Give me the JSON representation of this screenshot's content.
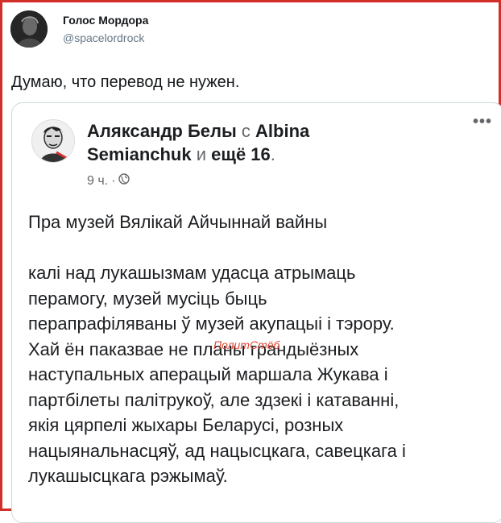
{
  "tweet": {
    "author_name": "Голос Мордора",
    "author_handle": "@spacelordrock",
    "text": "Думаю, что перевод не нужен."
  },
  "embedded_post": {
    "author": "Аляксандр Белы",
    "with_word": "с",
    "tagged_line1": "Albina",
    "tagged_line2": "Semianchuk",
    "and_word": "и",
    "others": "ещё 16",
    "period": ".",
    "time": "9 ч.",
    "separator": "·",
    "privacy_icon": "globe-icon",
    "more_icon": "more-dots-icon",
    "title": "Пра музей Вялікай Айчыннай вайны",
    "body_lines": [
      "калі над лукашызмам удасца атрымаць",
      "перамогу, музей мусіць быць",
      "перапрафіляваны ў музей акупацыі і тэрору.",
      "Хай ён паказвае не планы грандыёзных",
      "наступальных аперацый маршала Жукава і",
      "партбілеты палітрукоў, але здзекі і катаванні,",
      "якія цярпелі жыхары Беларусі, розных",
      "нацыянальнасцяў, ад нацысцкага, савецкага і",
      "лукашысцкага рэжымаў."
    ]
  },
  "watermark": "ПолитСтёб",
  "colors": {
    "frame_border": "#d22f2b",
    "text_primary": "#14171a",
    "text_secondary": "#657786",
    "watermark": "#e04a3a"
  }
}
